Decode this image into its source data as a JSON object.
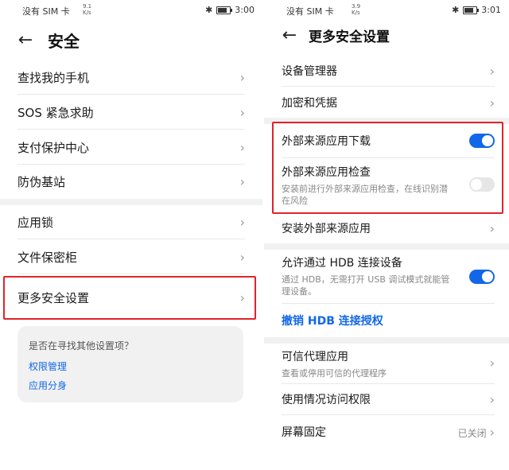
{
  "left": {
    "status": {
      "carrier": "没有 SIM 卡",
      "net_speed": "9.1",
      "net_unit": "K/s",
      "time": "3:00"
    },
    "title": "安全",
    "items": [
      {
        "label": "查找我的手机"
      },
      {
        "label": "SOS 紧急求助"
      },
      {
        "label": "支付保护中心"
      },
      {
        "label": "防伪基站"
      },
      {
        "label": "应用锁"
      },
      {
        "label": "文件保密柜"
      },
      {
        "label": "更多安全设置"
      }
    ],
    "card": {
      "question": "是否在寻找其他设置项？",
      "links": [
        "权限管理",
        "应用分身"
      ]
    }
  },
  "right": {
    "status": {
      "carrier": "没有 SIM 卡",
      "net_speed": "3.9",
      "net_unit": "K/s",
      "time": "3:01"
    },
    "title": "更多安全设置",
    "items": {
      "device_admin": "设备管理器",
      "encryption": "加密和凭据",
      "external_download": "外部来源应用下载",
      "external_check": "外部来源应用检查",
      "external_check_desc": "安装前进行外部来源应用检查，在线识别潜在风险",
      "install_external": "安装外部来源应用",
      "hdb": "允许通过 HDB 连接设备",
      "hdb_desc": "通过 HDB，无需打开 USB 调试模式就能管理设备。",
      "revoke_hdb": "撤销 HDB 连接授权",
      "trusted_agents": "可信代理应用",
      "trusted_agents_desc": "查看或停用可信的代理程序",
      "usage_access": "使用情况访问权限",
      "screen_pin": "屏幕固定",
      "screen_pin_status": "已关闭"
    },
    "toggles": {
      "external_download": "on",
      "external_check": "off",
      "hdb": "on"
    }
  },
  "colors": {
    "accent": "#1267e8",
    "highlight_border": "#e0242c",
    "toggle_off": "#e6e6e6"
  }
}
